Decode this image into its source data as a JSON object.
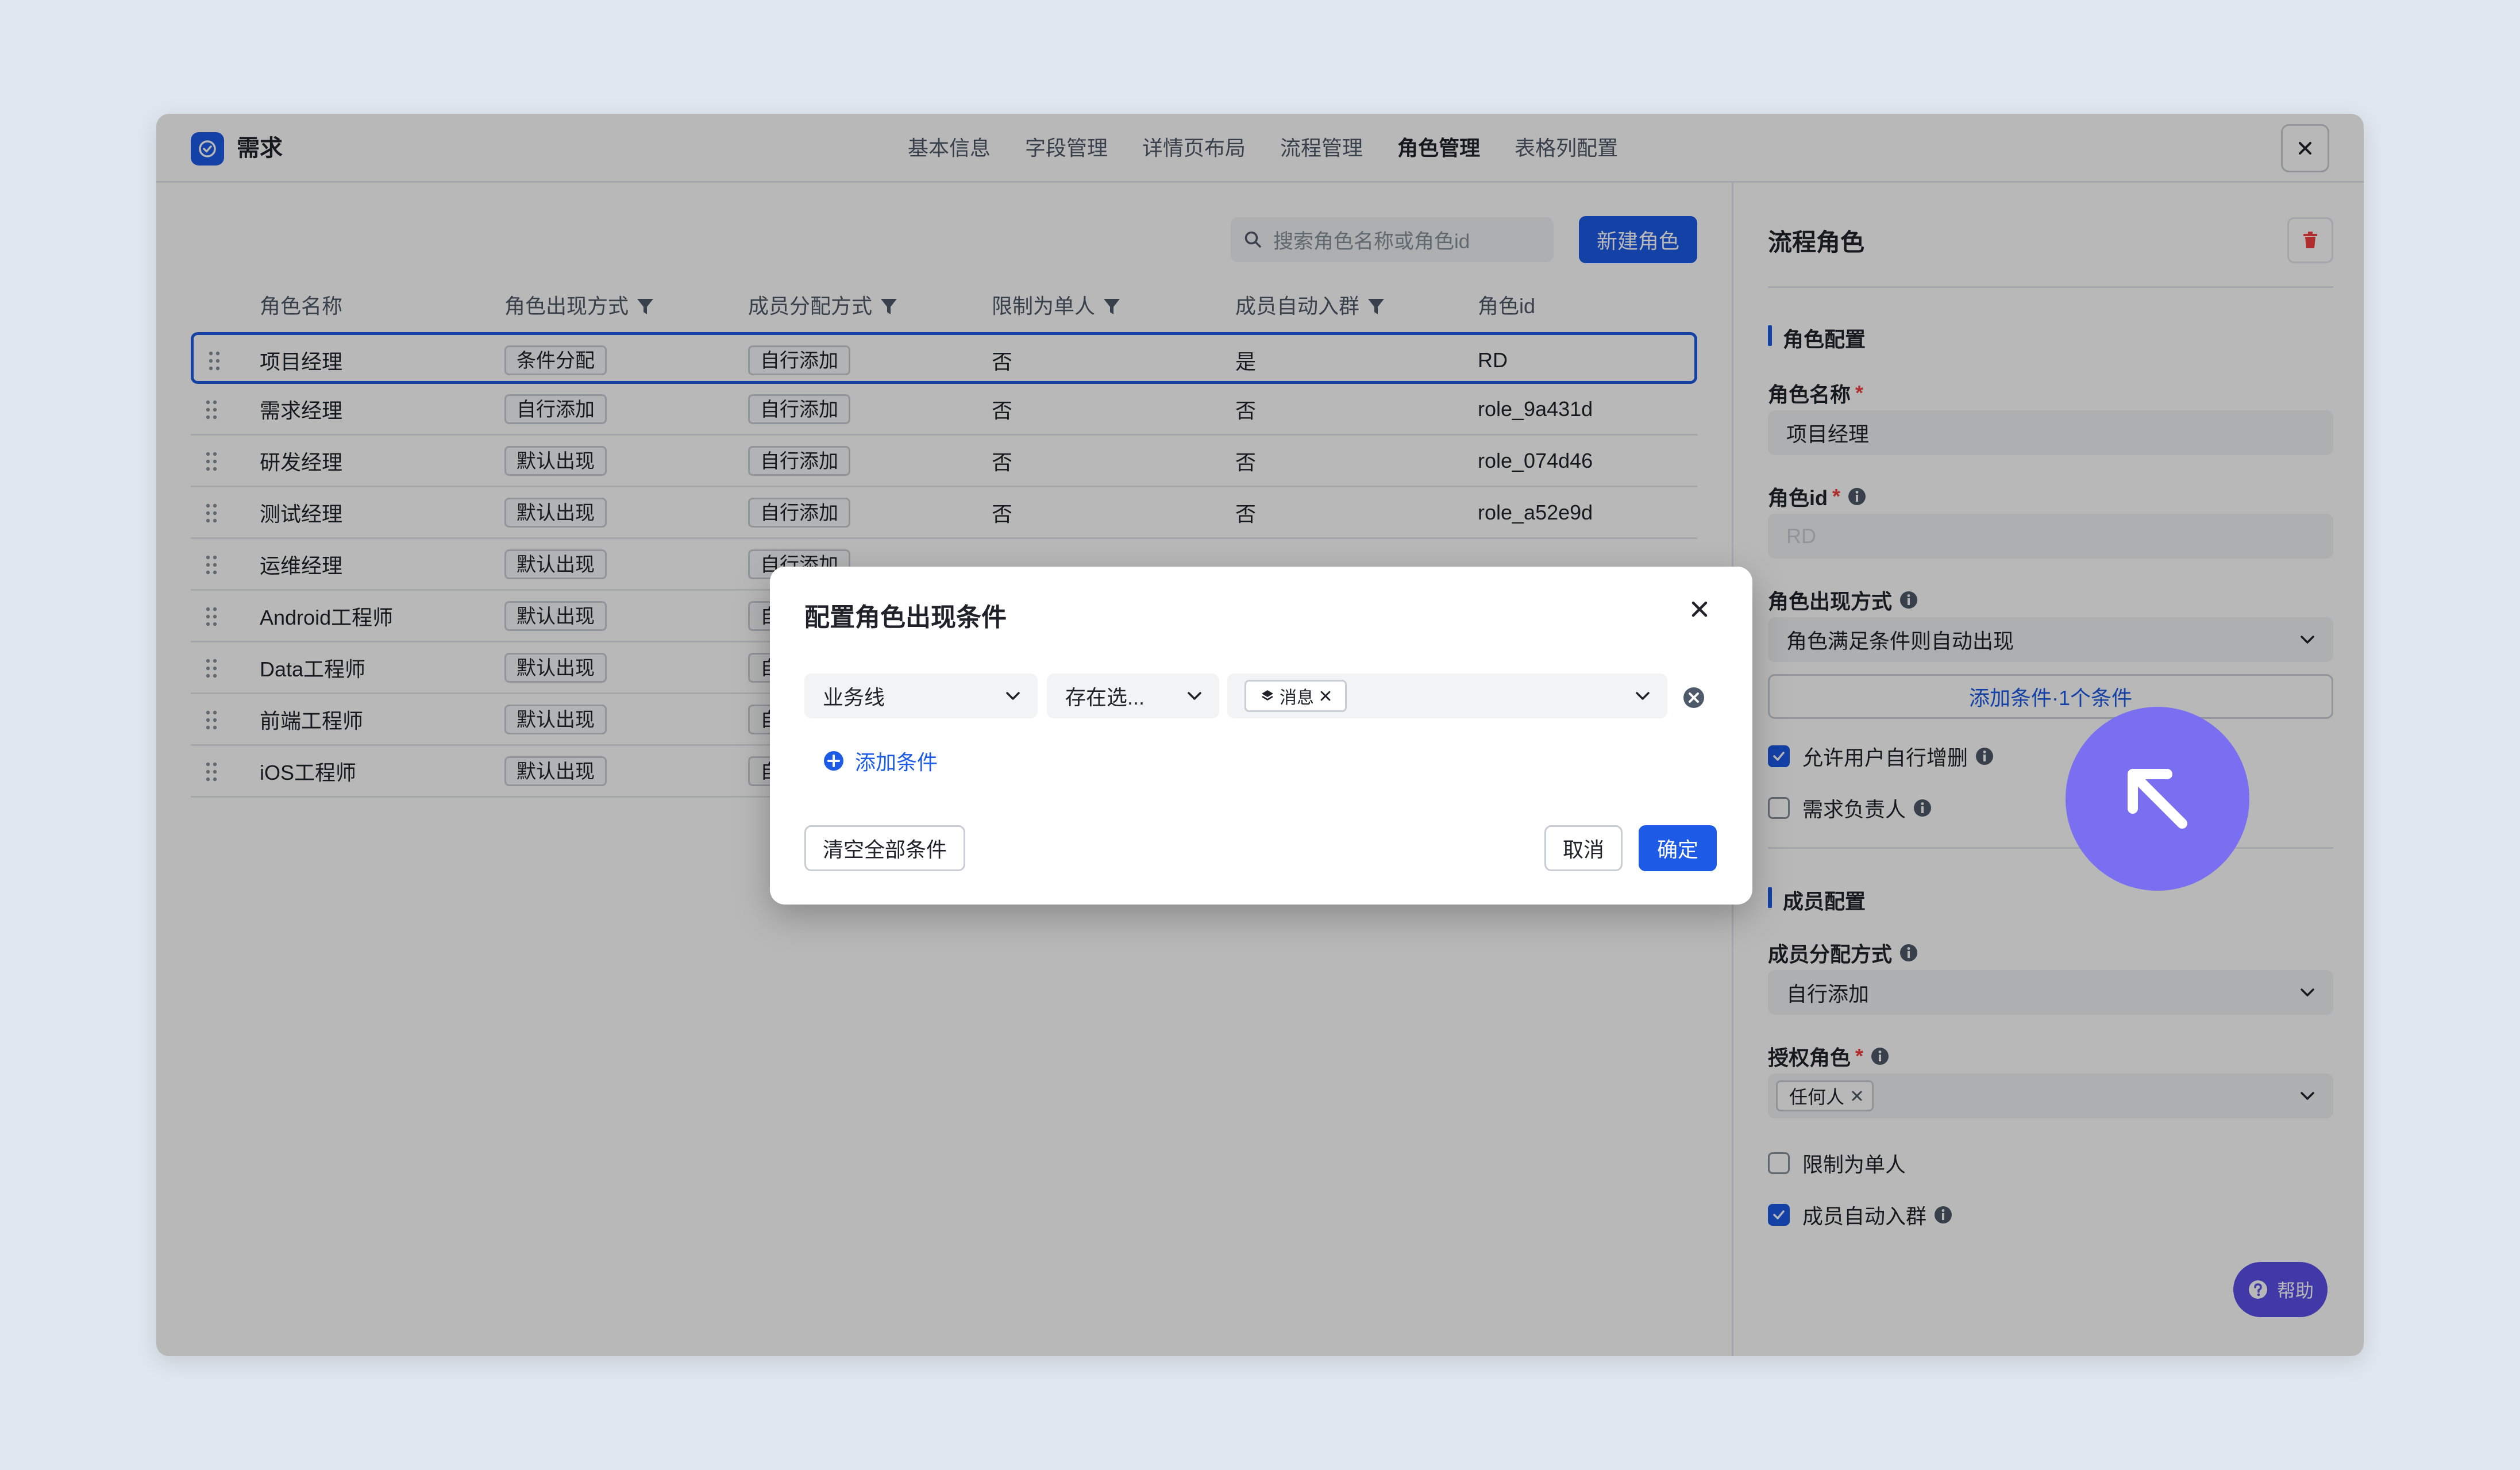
{
  "app": {
    "title": "需求"
  },
  "tabs": [
    {
      "label": "基本信息"
    },
    {
      "label": "字段管理"
    },
    {
      "label": "详情页布局"
    },
    {
      "label": "流程管理"
    },
    {
      "label": "角色管理"
    },
    {
      "label": "表格列配置"
    }
  ],
  "toolbar": {
    "search_placeholder": "搜索角色名称或角色id",
    "new_role_label": "新建角色"
  },
  "table": {
    "headers": [
      "角色名称",
      "角色出现方式",
      "成员分配方式",
      "限制为单人",
      "成员自动入群",
      "角色id"
    ],
    "rows": [
      {
        "name": "项目经理",
        "appear": "条件分配",
        "assign": "自行添加",
        "single": "否",
        "group": "是",
        "id": "RD"
      },
      {
        "name": "需求经理",
        "appear": "自行添加",
        "assign": "自行添加",
        "single": "否",
        "group": "否",
        "id": "role_9a431d"
      },
      {
        "name": "研发经理",
        "appear": "默认出现",
        "assign": "自行添加",
        "single": "否",
        "group": "否",
        "id": "role_074d46"
      },
      {
        "name": "测试经理",
        "appear": "默认出现",
        "assign": "自行添加",
        "single": "否",
        "group": "否",
        "id": "role_a52e9d"
      },
      {
        "name": "运维经理",
        "appear": "默认出现",
        "assign": "自行添加",
        "single": "",
        "group": "",
        "id": ""
      },
      {
        "name": "Android工程师",
        "appear": "默认出现",
        "assign": "自",
        "single": "",
        "group": "",
        "id": ""
      },
      {
        "name": "Data工程师",
        "appear": "默认出现",
        "assign": "自",
        "single": "",
        "group": "",
        "id": ""
      },
      {
        "name": "前端工程师",
        "appear": "默认出现",
        "assign": "自",
        "single": "",
        "group": "",
        "id": ""
      },
      {
        "name": "iOS工程师",
        "appear": "默认出现",
        "assign": "自",
        "single": "",
        "group": "",
        "id": ""
      }
    ]
  },
  "side": {
    "title": "流程角色",
    "role_section": "角色配置",
    "name_label": "角色名称",
    "name_value": "项目经理",
    "id_label": "角色id",
    "id_value": "RD",
    "appear_label": "角色出现方式",
    "appear_value": "角色满足条件则自动出现",
    "add_condition": "添加条件·1个条件",
    "allow_user_edit": "允许用户自行增删",
    "req_owner": "需求负责人",
    "member_section": "成员配置",
    "assign_label": "成员分配方式",
    "assign_value": "自行添加",
    "auth_label": "授权角色",
    "auth_chip": "任何人",
    "limit_single": "限制为单人",
    "auto_group": "成员自动入群",
    "help": "帮助"
  },
  "required_mark": "*",
  "modal": {
    "title": "配置角色出现条件",
    "field_value": "业务线",
    "operator_value": "存在选...",
    "value_chip": "消息",
    "add_condition": "添加条件",
    "clear_all": "清空全部条件",
    "cancel": "取消",
    "confirm": "确定"
  },
  "colors": {
    "primary": "#1d5be6",
    "danger": "#f53f3f",
    "cursor": "#7a6ff0"
  }
}
